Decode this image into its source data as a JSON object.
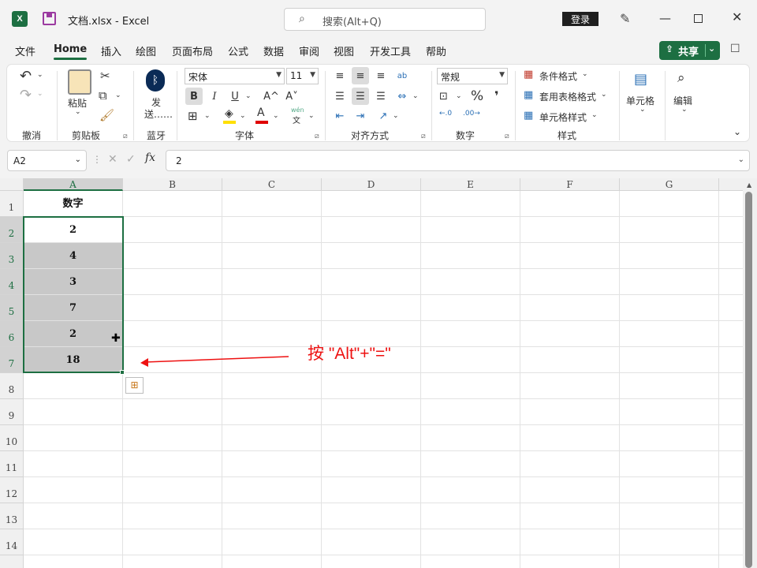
{
  "title_bar": {
    "app_icon_letter": "X",
    "doc_title": "文档.xlsx  -  Excel",
    "search_placeholder": "搜索(Alt+Q)",
    "login_label": "登录"
  },
  "menu_tabs": [
    "文件",
    "Home",
    "插入",
    "绘图",
    "页面布局",
    "公式",
    "数据",
    "审阅",
    "视图",
    "开发工具",
    "帮助"
  ],
  "active_tab": "Home",
  "share_label": "共享",
  "ribbon": {
    "groups": {
      "undo": "撤消",
      "clipboard": "剪贴板",
      "bluetooth": "蓝牙",
      "font": "字体",
      "alignment": "对齐方式",
      "number": "数字",
      "styles": "样式"
    },
    "paste_label": "粘贴",
    "send_label_1": "发",
    "send_label_2": "送……",
    "font_name": "宋体",
    "font_size": "11",
    "bold": "B",
    "italic": "I",
    "underline": "U",
    "grow_font": "A^",
    "shrink_font": "A˅",
    "font_color_letter": "A",
    "phonetic": "wén",
    "number_format": "常规",
    "percent": "%",
    "comma": "❜",
    "cond_format": "条件格式",
    "table_format": "套用表格格式",
    "cell_styles": "单元格样式",
    "cells_label": "单元格",
    "editing_label": "编辑",
    "wrap": "ab",
    "fill_color": "#ffe000",
    "font_color": "#e00000"
  },
  "formula_bar": {
    "name_box": "A2",
    "formula": "2",
    "fx": "fx"
  },
  "sheet": {
    "columns": [
      "A",
      "B",
      "C",
      "D",
      "E",
      "F",
      "G"
    ],
    "rows": [
      "1",
      "2",
      "3",
      "4",
      "5",
      "6",
      "7",
      "8",
      "9",
      "10",
      "11",
      "12",
      "13",
      "14"
    ],
    "column_a": [
      "数字",
      "2",
      "4",
      "3",
      "7",
      "2",
      "18"
    ]
  },
  "annotation": "按 \"Alt\"+\"=\"",
  "accent_color": "#1d6f42"
}
